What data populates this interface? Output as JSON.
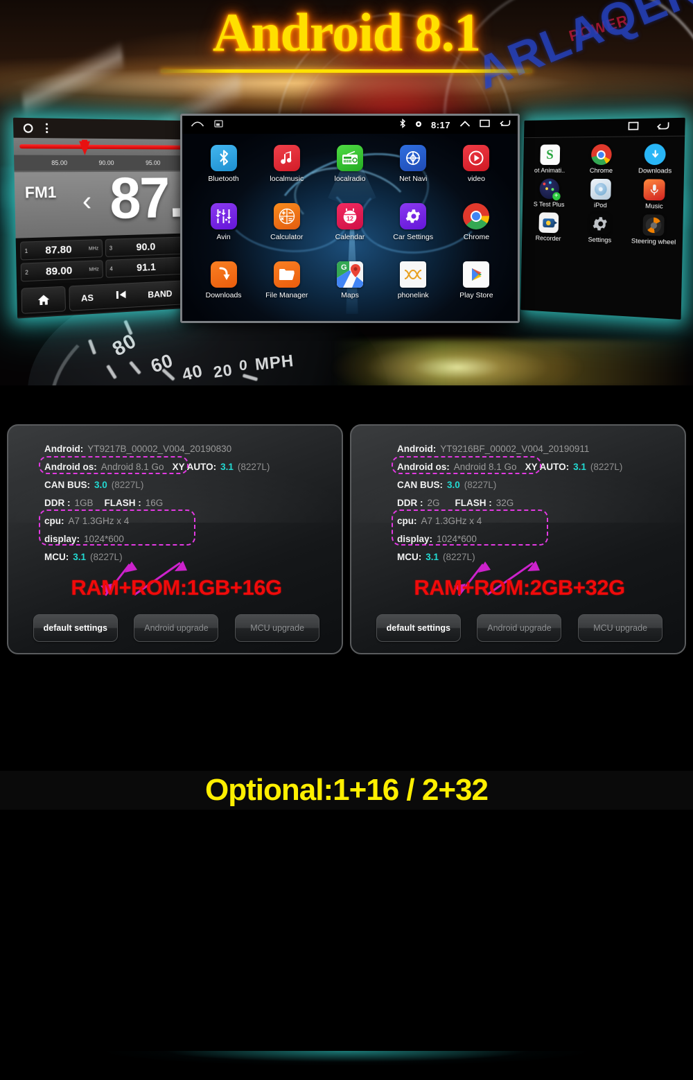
{
  "headline": {
    "title": "Android 8.1"
  },
  "watermarks": {
    "brand_blue": "ARLAQER",
    "brand_red": "POWER"
  },
  "fm_device": {
    "band": "FM1",
    "frequency_display": "87.",
    "scale_ticks": [
      "85.00",
      "90.00",
      "95.00"
    ],
    "presets": [
      {
        "num": "1",
        "value": "87.80",
        "unit": "MHz"
      },
      {
        "num": "3",
        "value": "90.0",
        "unit": ""
      },
      {
        "num": "2",
        "value": "89.00",
        "unit": "MHz"
      },
      {
        "num": "4",
        "value": "91.1",
        "unit": ""
      }
    ],
    "controls": {
      "home": "home-icon",
      "as": "AS",
      "prev": "prev-track-icon",
      "band": "BAND"
    }
  },
  "tablet": {
    "status": {
      "home_icon": "home-icon",
      "screenshot_icon": "screenshot-icon",
      "bluetooth_icon": "bluetooth-icon",
      "dot_icon": "circle-dot-icon",
      "time": "8:17",
      "chevron_up_icon": "chevron-up-icon",
      "recents_icon": "recents-icon",
      "back_icon": "back-icon"
    },
    "apps": [
      {
        "label": "Bluetooth",
        "icon": "bluetooth-icon"
      },
      {
        "label": "localmusic",
        "icon": "music-note-icon"
      },
      {
        "label": "localradio",
        "icon": "radio-icon"
      },
      {
        "label": "Net Navi",
        "icon": "compass-icon"
      },
      {
        "label": "video",
        "icon": "play-circle-icon"
      },
      {
        "label": "Avin",
        "icon": "avin-icon"
      },
      {
        "label": "Calculator",
        "icon": "calculator-icon"
      },
      {
        "label": "Calendar",
        "icon": "calendar-icon"
      },
      {
        "label": "Car Settings",
        "icon": "gear-icon"
      },
      {
        "label": "Chrome",
        "icon": "chrome-icon"
      },
      {
        "label": "Downloads",
        "icon": "download-arrow-icon"
      },
      {
        "label": "File Manager",
        "icon": "folder-icon"
      },
      {
        "label": "Maps",
        "icon": "maps-pin-icon"
      },
      {
        "label": "phonelink",
        "icon": "phonelink-icon"
      },
      {
        "label": "Play Store",
        "icon": "play-store-icon"
      }
    ]
  },
  "right_device": {
    "status": {
      "recents_icon": "recents-icon",
      "back_icon": "back-icon"
    },
    "apps": [
      {
        "label": "ot Animati..",
        "icon": "boot-animation-icon"
      },
      {
        "label": "Chrome",
        "icon": "chrome-icon"
      },
      {
        "label": "Downloads",
        "icon": "download-arrow-icon"
      },
      {
        "label": "S Test Plus",
        "icon": "gps-test-icon"
      },
      {
        "label": "iPod",
        "icon": "ipod-icon"
      },
      {
        "label": "Music",
        "icon": "microphone-icon"
      },
      {
        "label": "Recorder",
        "icon": "recorder-icon"
      },
      {
        "label": "Settings",
        "icon": "gear-icon"
      },
      {
        "label": "Steering wheel",
        "icon": "steering-wheel-icon"
      }
    ]
  },
  "optional_banner": {
    "text": "Optional:1+16 / 2+32"
  },
  "colors": {
    "headline_yellow": "#ffe000",
    "banner_yellow": "#ffef00",
    "ram_red": "#f00a0a",
    "value_cyan": "#22d9d1",
    "dash_magenta": "#e23ae2",
    "teal_glow": "#3ce6e1"
  },
  "panels": [
    {
      "name": "1gb-16g",
      "rows": [
        {
          "key": "Android:",
          "value": "YT9217B_00002_V004_20190830"
        },
        {
          "key": "Android os:",
          "value": "Android 8.1 Go",
          "key2": "XY AUTO:",
          "cyan": "3.1",
          "paren": "(8227L)"
        },
        {
          "key": "CAN BUS:",
          "cyan": "3.0",
          "paren": "(8227L)"
        },
        {
          "key": "DDR :",
          "value": "1GB",
          "key2": "FLASH :",
          "value2": "16G"
        },
        {
          "key": "cpu:",
          "value": "A7 1.3GHz x 4"
        },
        {
          "key": "display:",
          "value": "1024*600"
        },
        {
          "key": "MCU:",
          "cyan": "3.1",
          "paren": "(8227L)"
        }
      ],
      "ram_rom": "RAM+ROM:1GB+16G",
      "buttons": [
        {
          "label": "default settings",
          "state": "on"
        },
        {
          "label": "Android upgrade",
          "state": "off"
        },
        {
          "label": "MCU upgrade",
          "state": "off"
        }
      ]
    },
    {
      "name": "2gb-32g",
      "rows": [
        {
          "key": "Android:",
          "value": "YT9216BF_00002_V004_20190911"
        },
        {
          "key": "Android os:",
          "value": "Android 8.1 Go",
          "key2": "XY AUTO:",
          "cyan": "3.1",
          "paren": "(8227L)"
        },
        {
          "key": "CAN BUS:",
          "cyan": "3.0",
          "paren": "(8227L)"
        },
        {
          "key": "DDR :",
          "value": "2G",
          "key2": "FLASH :",
          "value2": "32G"
        },
        {
          "key": "cpu:",
          "value": "A7 1.3GHz x 4"
        },
        {
          "key": "display:",
          "value": "1024*600"
        },
        {
          "key": "MCU:",
          "cyan": "3.1",
          "paren": "(8227L)"
        }
      ],
      "ram_rom": "RAM+ROM:2GB+32G",
      "buttons": [
        {
          "label": "default settings",
          "state": "on"
        },
        {
          "label": "Android upgrade",
          "state": "off"
        },
        {
          "label": "MCU upgrade",
          "state": "off"
        }
      ]
    }
  ],
  "speedometer": {
    "marks": [
      "80",
      "60",
      "40",
      "20",
      "0"
    ],
    "unit": "MPH"
  }
}
